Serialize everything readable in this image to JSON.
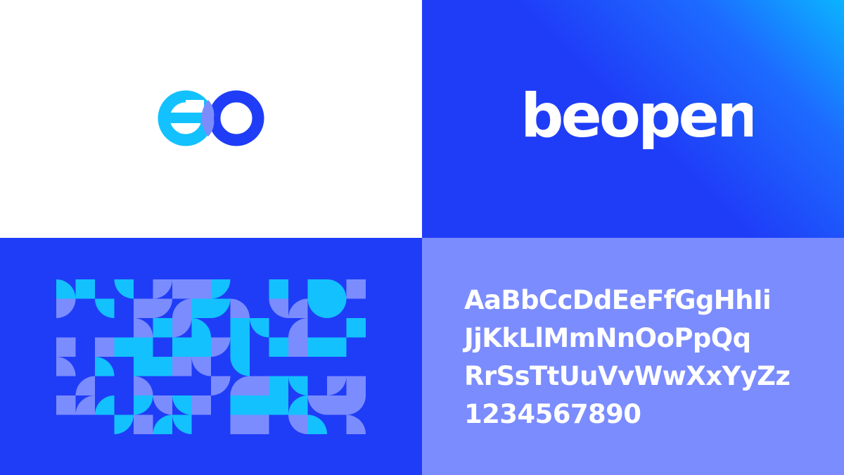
{
  "brand": {
    "wordmark": "beopen",
    "colors": {
      "royal_blue": "#1f3df7",
      "cyan": "#13c1ff",
      "periwinkle": "#7b8cff",
      "white": "#ffffff"
    }
  },
  "type_specimen": {
    "lines": [
      "AaBbCcDdEeFfGgHhIi",
      "JjKkLlMmNnOoPpQq",
      "RrSsTtUuVvWwXxYyZz",
      "1234567890"
    ]
  }
}
